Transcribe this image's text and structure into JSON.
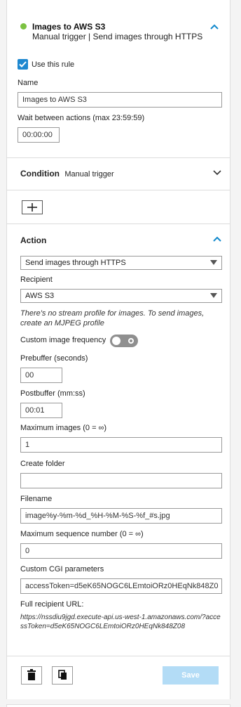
{
  "rule": {
    "status_color": "#7cc242",
    "title": "Images to AWS S3",
    "subtitle": "Manual trigger | Send images through HTTPS",
    "use_rule_label": "Use this rule",
    "use_rule_checked": true,
    "name_label": "Name",
    "name_value": "Images to AWS S3",
    "wait_label": "Wait between actions (max 23:59:59)",
    "wait_value": "00:00:00"
  },
  "condition": {
    "title": "Condition",
    "value": "Manual trigger"
  },
  "action": {
    "title": "Action",
    "type_value": "Send images through HTTPS",
    "recipient_label": "Recipient",
    "recipient_value": "AWS S3",
    "hint": "There's no stream profile for images. To send images, create an MJPEG profile",
    "frequency_label": "Custom image frequency",
    "frequency_on": false,
    "prebuffer_label": "Prebuffer (seconds)",
    "prebuffer_value": "00",
    "postbuffer_label": "Postbuffer (mm:ss)",
    "postbuffer_value": "00:01",
    "max_images_label": "Maximum images (0 = ∞)",
    "max_images_value": "1",
    "folder_label": "Create folder",
    "folder_value": "",
    "filename_label": "Filename",
    "filename_value": "image%y-%m-%d_%H-%M-%S-%f_#s.jpg",
    "max_seq_label": "Maximum sequence number (0 = ∞)",
    "max_seq_value": "0",
    "cgi_label": "Custom CGI parameters",
    "cgi_value": "accessToken=d5eK65NOGC6LEmtoiORz0HEqNk848Z0",
    "url_label": "Full recipient URL:",
    "url_value": "https://nssdiu9jgd.execute-api.us-west-1.amazonaws.com/?accessToken=d5eK65NOGC6LEmtoiORz0HEqNk848Z08"
  },
  "footer": {
    "save_label": "Save",
    "accent": "#b3dcf6"
  },
  "icons": {
    "collapse": "chevron-up-icon",
    "expand": "chevron-down-icon",
    "add": "plus-icon",
    "delete": "trash-icon",
    "copy": "copy-icon"
  }
}
